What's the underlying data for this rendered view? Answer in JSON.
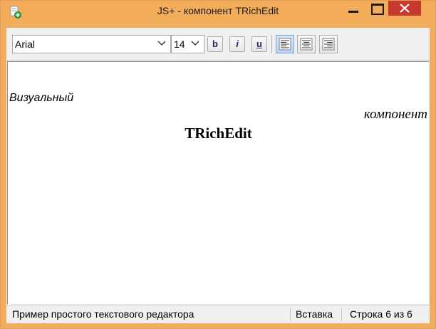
{
  "window": {
    "title": "JS+ - компонент TRichEdit"
  },
  "toolbar": {
    "font_name": "Arial",
    "font_size": "14",
    "bold_label": "b",
    "italic_label": "i",
    "underline_label": "u",
    "align_active": "left"
  },
  "editor": {
    "lines": [
      "Визуальный",
      "компонент",
      "TRichEdit"
    ]
  },
  "status": {
    "message": "Пример простого текстового редактора",
    "mode": "Вставка",
    "position": "Строка 6 из 6"
  },
  "colors": {
    "title_bar": "#f2ac5a",
    "close_button": "#c7392f",
    "active_align": "#b9d8f4"
  },
  "icons": [
    "app-icon",
    "minimize-icon",
    "maximize-icon",
    "close-icon",
    "chevron-down-icon",
    "align-left-icon",
    "align-center-icon",
    "align-right-icon"
  ]
}
